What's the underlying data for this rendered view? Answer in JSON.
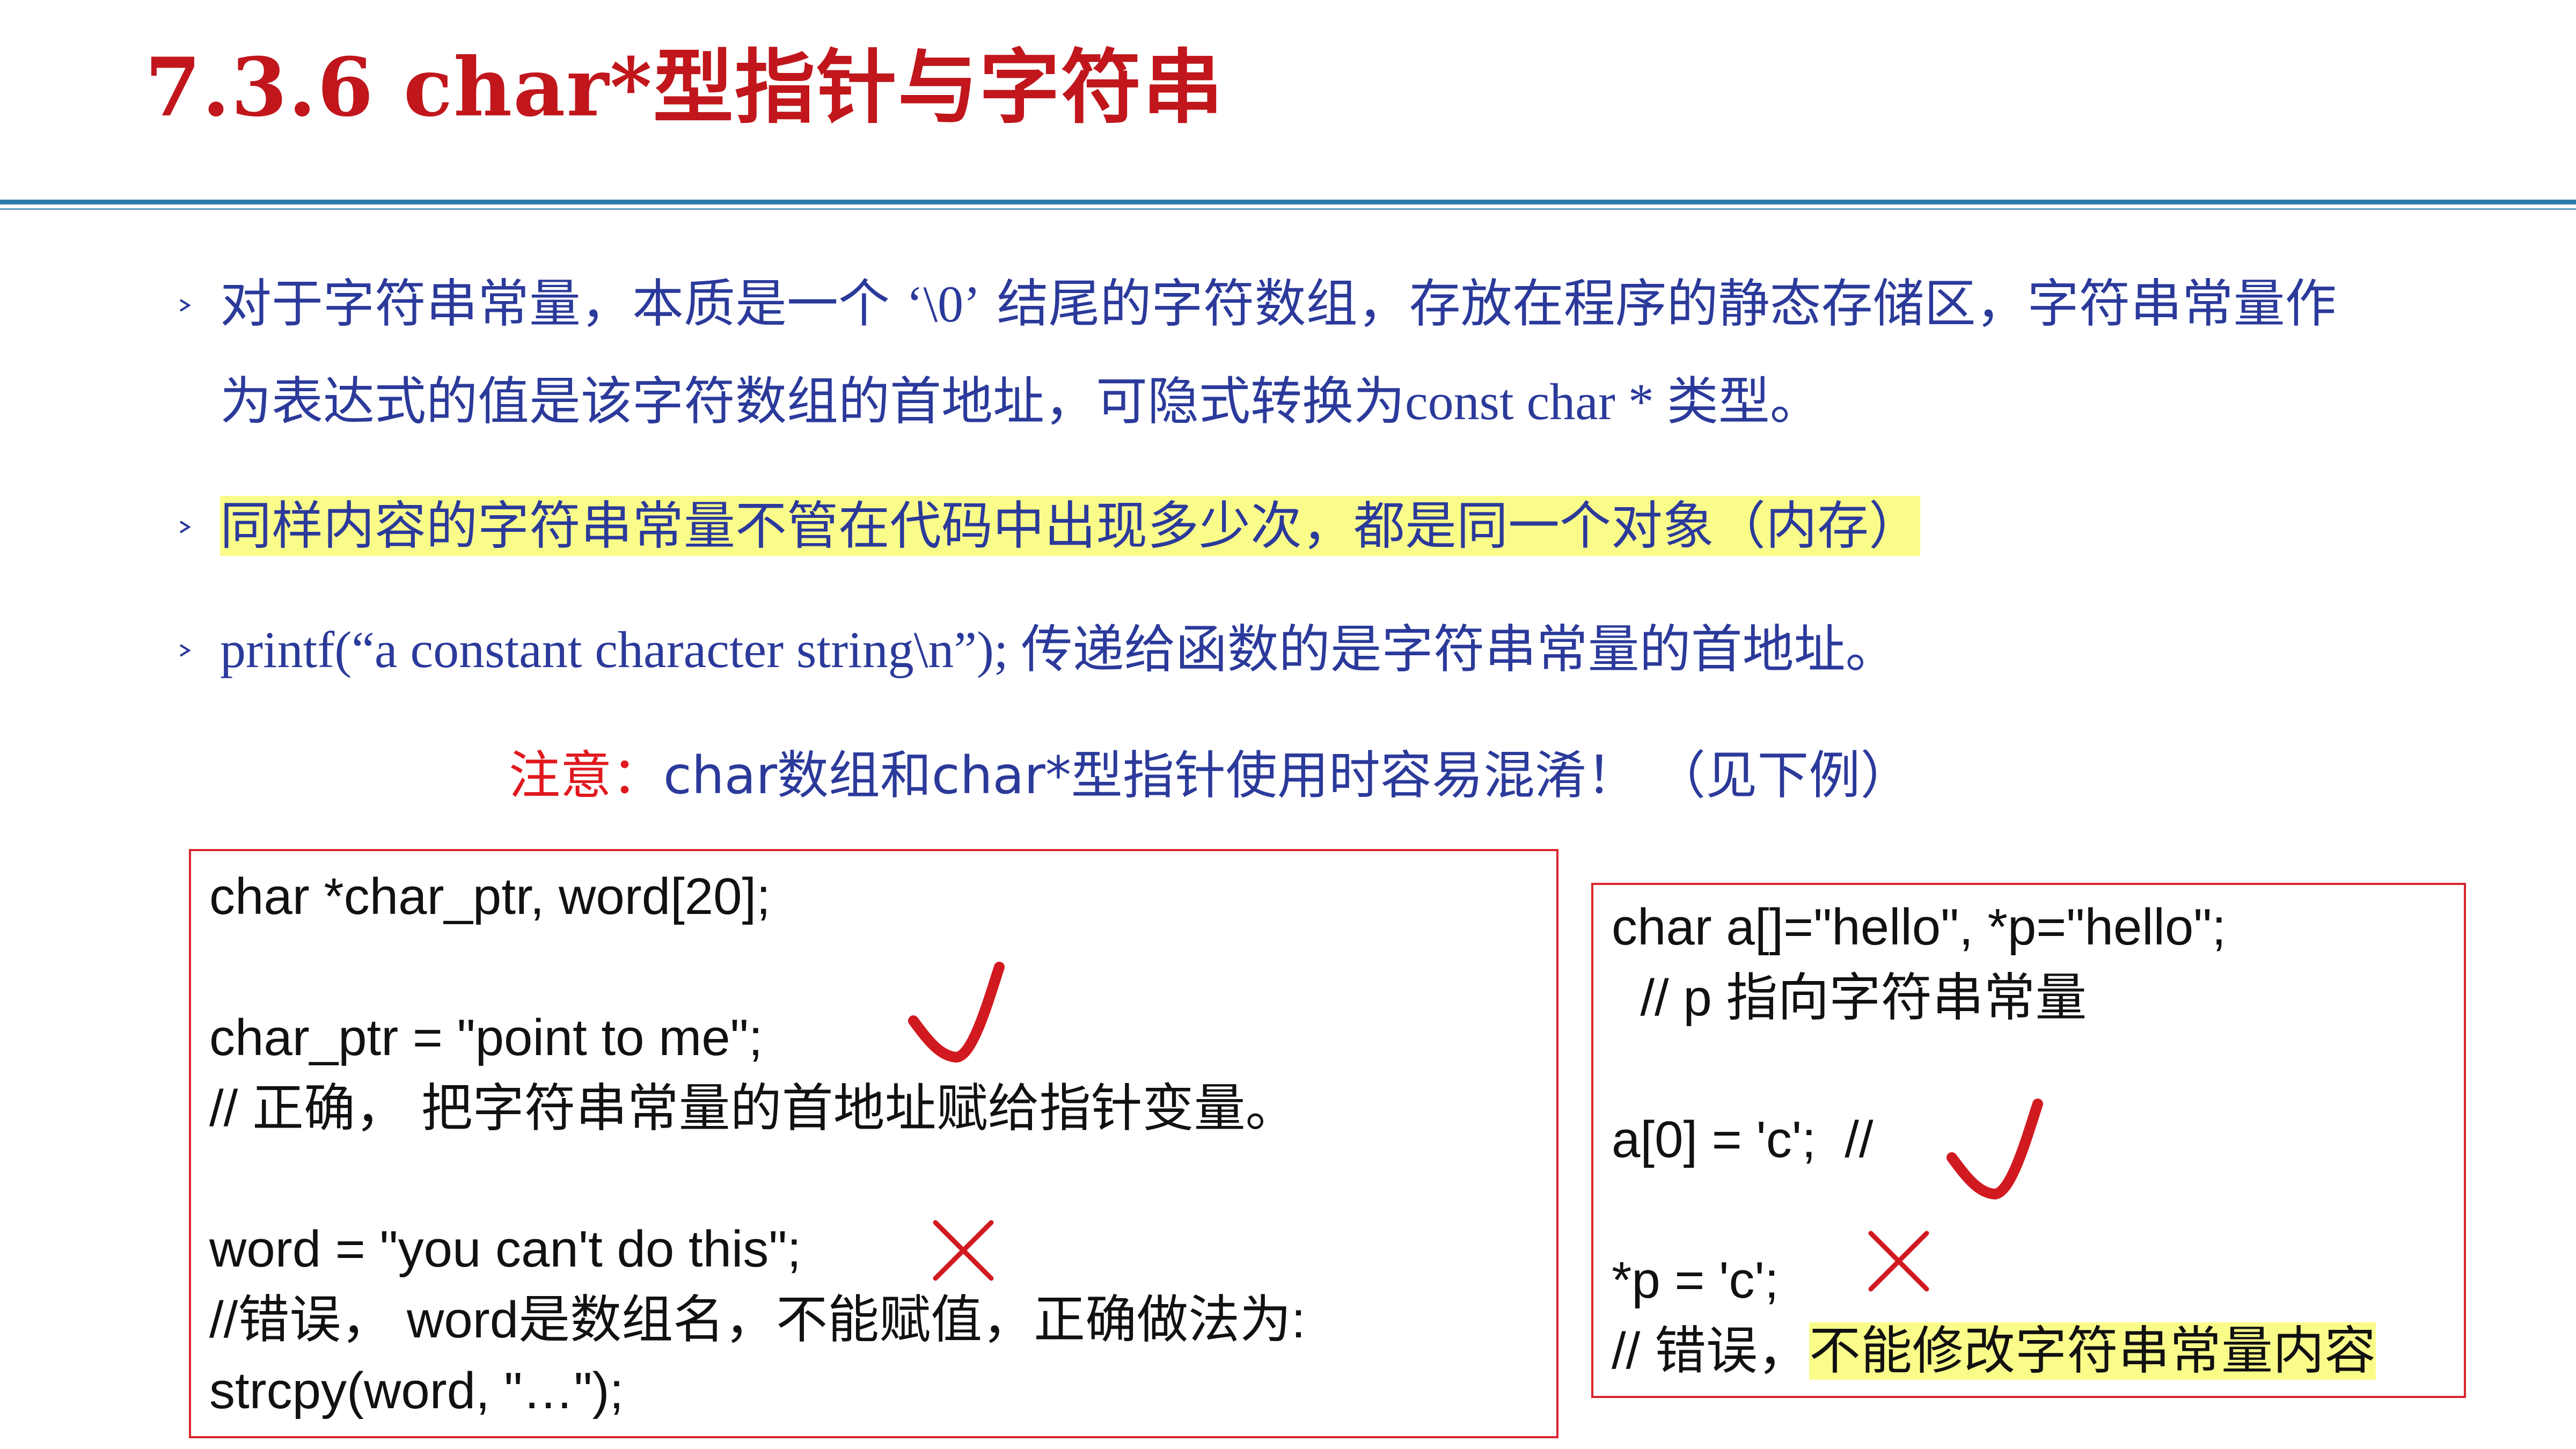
{
  "title": "7.3.6 char*型指针与字符串",
  "colors": {
    "title": "#c0161c",
    "body_text": "#2b3a9a",
    "accent_red": "#e0191f",
    "highlight": "#fafc8a",
    "rule": "#2e7aa8"
  },
  "bullets": {
    "b1": {
      "line1_a": "对于字符串常量，本质是一个 ",
      "line1_code": "‘\\0’",
      "line1_b": " 结尾的字符数组，存放在程序的静态存储区，字符串常量作",
      "line2_a": "为表达式的值是该字符数组的首地址，可隐式转换为",
      "line2_code": "const char * ",
      "line2_b": "类型。"
    },
    "b2": {
      "text": "同样内容的字符串常量不管在代码中出现多少次，都是同一个对象（内存） "
    },
    "b3": {
      "code": "printf(“a constant character string\\n”); ",
      "text": "传递给函数的是字符串常量的首地址。"
    }
  },
  "note": {
    "label": "注意：",
    "text": "char数组和char*型指针使用时容易混淆！ （见下例）"
  },
  "left_box": {
    "line1": "char *char_ptr, word[20];",
    "line2": "char_ptr = \"point to me\";",
    "line3": "// 正确， 把字符串常量的首地址赋给指针变量。",
    "line4": "word = \"you can't do this\";",
    "line5": "//错误， word是数组名，不能赋值，正确做法为:",
    "line6": "strcpy(word, \"…\");"
  },
  "right_box": {
    "line1": "char a[]=\"hello\", *p=\"hello\";",
    "line2": "  // p 指向字符串常量",
    "line3": "a[0] = 'c';  //",
    "line4": "*p = 'c';",
    "line5_a": "// 错误，",
    "line5_b": "不能修改字符串常量内容"
  },
  "icons": {
    "correct": "check-mark-icon",
    "wrong": "cross-mark-icon",
    "bullet": "chevron-right-icon"
  }
}
